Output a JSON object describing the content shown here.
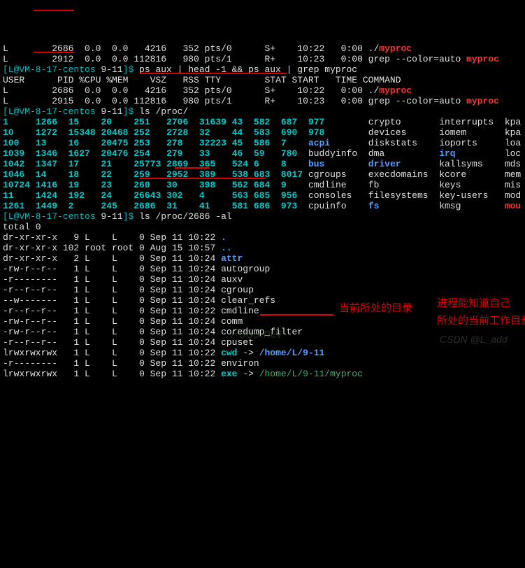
{
  "ps1": [
    {
      "user": "L",
      "pid": "2686",
      "cpu": "0.0",
      "mem": "0.0",
      "vsz": "4216",
      "rss": "352",
      "tty": "pts/0",
      "stat": "S+",
      "start": "10:22",
      "time": "0:00",
      "cmd": "./",
      "cmdsfx": "myproc"
    },
    {
      "user": "L",
      "pid": "2912",
      "cpu": "0.0",
      "mem": "0.0",
      "vsz": "112816",
      "rss": "980",
      "tty": "pts/1",
      "stat": "R+",
      "start": "10:23",
      "time": "0:00",
      "cmd": "grep --color=auto ",
      "cmdsfx": "myproc"
    }
  ],
  "prompt1": {
    "user": "L",
    "host": "VM-8-17-centos",
    "cwd": "9-11",
    "cmd": "ps aux | head -1 && ps aux | grep myproc"
  },
  "ps_header": {
    "user": "USER",
    "pid": "PID",
    "cpu": "%CPU",
    "mem": "%MEM",
    "vsz": "VSZ",
    "rss": "RSS",
    "tty": "TTY",
    "stat": "STAT",
    "start": "START",
    "time": "TIME",
    "cmd": "COMMAND"
  },
  "ps2": [
    {
      "user": "L",
      "pid": "2686",
      "cpu": "0.0",
      "mem": "0.0",
      "vsz": "4216",
      "rss": "352",
      "tty": "pts/0",
      "stat": "S+",
      "start": "10:22",
      "time": "0:00",
      "cmd": "./",
      "cmdsfx": "myproc"
    },
    {
      "user": "L",
      "pid": "2915",
      "cpu": "0.0",
      "mem": "0.0",
      "vsz": "112816",
      "rss": "980",
      "tty": "pts/1",
      "stat": "R+",
      "start": "10:23",
      "time": "0:00",
      "cmd": "grep --color=auto ",
      "cmdsfx": "myproc"
    }
  ],
  "prompt2": {
    "user": "L",
    "host": "VM-8-17-centos",
    "cwd": "9-11",
    "cmd": "ls /proc/"
  },
  "proc_rows": [
    [
      "1",
      "1266",
      "15",
      "20",
      "251",
      "2706",
      "31639",
      "43",
      "582",
      "687",
      "977",
      "",
      "crypto",
      "interrupts",
      "kpa"
    ],
    [
      "10",
      "1272",
      "15348",
      "20468",
      "252",
      "2728",
      "32",
      "44",
      "583",
      "690",
      "978",
      "",
      "devices",
      "iomem",
      "kpa"
    ],
    [
      "100",
      "13",
      "16",
      "20475",
      "253",
      "278",
      "32223",
      "45",
      "586",
      "7",
      "acpi",
      "",
      "diskstats",
      "ioports",
      "loa"
    ],
    [
      "1039",
      "1346",
      "1627",
      "20476",
      "254",
      "279",
      "33",
      "46",
      "59",
      "780",
      "buddyinfo",
      "",
      "dma",
      "irq",
      "loc"
    ],
    [
      "1042",
      "1347",
      "17",
      "21",
      "25773",
      "2869",
      "365",
      "524",
      "6",
      "8",
      "bus",
      "",
      "driver",
      "kallsyms",
      "mds"
    ],
    [
      "1046",
      "14",
      "18",
      "22",
      "259",
      "2952",
      "389",
      "538",
      "683",
      "8017",
      "cgroups",
      "",
      "execdomains",
      "kcore",
      "mem"
    ],
    [
      "10724",
      "1416",
      "19",
      "23",
      "260",
      "30",
      "398",
      "562",
      "684",
      "9",
      "cmdline",
      "",
      "fb",
      "keys",
      "mis"
    ],
    [
      "11",
      "1424",
      "192",
      "24",
      "26643",
      "302",
      "4",
      "563",
      "685",
      "956",
      "consoles",
      "",
      "filesystems",
      "key-users",
      "mod"
    ],
    [
      "1261",
      "1449",
      "2",
      "245",
      "2686",
      "31",
      "41",
      "581",
      "686",
      "973",
      "cpuinfo",
      "",
      "fs",
      "kmsg",
      "mou"
    ]
  ],
  "proc_styles": [
    [
      "cb",
      "cb",
      "cb",
      "cb",
      "cb",
      "cb",
      "cb",
      "cb",
      "cb",
      "cb",
      "cb",
      "",
      "w",
      "w",
      "w"
    ],
    [
      "cb",
      "cb",
      "cb",
      "cb",
      "cb",
      "cb",
      "cb",
      "cb",
      "cb",
      "cb",
      "cb",
      "",
      "w",
      "w",
      "w"
    ],
    [
      "cb",
      "cb",
      "cb",
      "cb",
      "cb",
      "cb",
      "cb",
      "cb",
      "cb",
      "cb",
      "bb",
      "",
      "w",
      "w",
      "w"
    ],
    [
      "cb",
      "cb",
      "cb",
      "cb",
      "cb",
      "cb",
      "cb",
      "cb",
      "cb",
      "cb",
      "w",
      "",
      "w",
      "bb",
      "w"
    ],
    [
      "cb",
      "cb",
      "cb",
      "cb",
      "cb",
      "cb",
      "cb",
      "cb",
      "cb",
      "cb",
      "bb",
      "",
      "bb",
      "w",
      "w"
    ],
    [
      "cb",
      "cb",
      "cb",
      "cb",
      "cb",
      "cb",
      "cb",
      "cb",
      "cb",
      "cb",
      "w",
      "",
      "w",
      "w",
      "w"
    ],
    [
      "cb",
      "cb",
      "cb",
      "cb",
      "cb",
      "cb",
      "cb",
      "cb",
      "cb",
      "cb",
      "w",
      "",
      "w",
      "w",
      "w"
    ],
    [
      "cb",
      "cb",
      "cb",
      "cb",
      "cb",
      "cb",
      "cb",
      "cb",
      "cb",
      "cb",
      "w",
      "",
      "w",
      "w",
      "w"
    ],
    [
      "cb",
      "cb",
      "cb",
      "cb",
      "cb",
      "cb",
      "cb",
      "cb",
      "cb",
      "cb",
      "w",
      "",
      "bb",
      "w",
      "rb"
    ]
  ],
  "prompt3": {
    "user": "L",
    "host": "VM-8-17-centos",
    "cwd": "9-11",
    "cmd": "ls /proc/2686 -al"
  },
  "total": "total 0",
  "ls": [
    {
      "perm": "dr-xr-xr-x",
      "ln": "9",
      "own": "L",
      "grp": "L",
      "sz": "0",
      "date": "Sep 11 10:22",
      "name": ".",
      "cls": "bb"
    },
    {
      "perm": "dr-xr-xr-x",
      "ln": "102",
      "own": "root",
      "grp": "root",
      "sz": "0",
      "date": "Aug 15 10:57",
      "name": "..",
      "cls": "bb"
    },
    {
      "perm": "dr-xr-xr-x",
      "ln": "2",
      "own": "L",
      "grp": "L",
      "sz": "0",
      "date": "Sep 11 10:24",
      "name": "attr",
      "cls": "bb"
    },
    {
      "perm": "-rw-r--r--",
      "ln": "1",
      "own": "L",
      "grp": "L",
      "sz": "0",
      "date": "Sep 11 10:24",
      "name": "autogroup",
      "cls": "w"
    },
    {
      "perm": "-r--------",
      "ln": "1",
      "own": "L",
      "grp": "L",
      "sz": "0",
      "date": "Sep 11 10:24",
      "name": "auxv",
      "cls": "w"
    },
    {
      "perm": "-r--r--r--",
      "ln": "1",
      "own": "L",
      "grp": "L",
      "sz": "0",
      "date": "Sep 11 10:24",
      "name": "cgroup",
      "cls": "w"
    },
    {
      "perm": "--w-------",
      "ln": "1",
      "own": "L",
      "grp": "L",
      "sz": "0",
      "date": "Sep 11 10:24",
      "name": "clear_refs",
      "cls": "w"
    },
    {
      "perm": "-r--r--r--",
      "ln": "1",
      "own": "L",
      "grp": "L",
      "sz": "0",
      "date": "Sep 11 10:22",
      "name": "cmdline",
      "cls": "w"
    },
    {
      "perm": "-rw-r--r--",
      "ln": "1",
      "own": "L",
      "grp": "L",
      "sz": "0",
      "date": "Sep 11 10:24",
      "name": "comm",
      "cls": "w"
    },
    {
      "perm": "-rw-r--r--",
      "ln": "1",
      "own": "L",
      "grp": "L",
      "sz": "0",
      "date": "Sep 11 10:24",
      "name": "coredump_filter",
      "cls": "w"
    },
    {
      "perm": "-r--r--r--",
      "ln": "1",
      "own": "L",
      "grp": "L",
      "sz": "0",
      "date": "Sep 11 10:24",
      "name": "cpuset",
      "cls": "w"
    },
    {
      "perm": "lrwxrwxrwx",
      "ln": "1",
      "own": "L",
      "grp": "L",
      "sz": "0",
      "date": "Sep 11 10:22",
      "name": "cwd",
      "cls": "cb",
      "arrow": " -> ",
      "target": "/home/L/9-11",
      "tcls": "bb"
    },
    {
      "perm": "-r--------",
      "ln": "1",
      "own": "L",
      "grp": "L",
      "sz": "0",
      "date": "Sep 11 10:22",
      "name": "environ",
      "cls": "w"
    },
    {
      "perm": "lrwxrwxrwx",
      "ln": "1",
      "own": "L",
      "grp": "L",
      "sz": "0",
      "date": "Sep 11 10:22",
      "name": "exe",
      "cls": "cb",
      "arrow": " -> ",
      "target": "/home/L/9-11/myproc",
      "tcls": "g"
    }
  ],
  "ann1": "当前所处的目录",
  "ann2": "进程能知道自己",
  "ann3": "所处的当前工作目录",
  "wm1": "CSDN @L_add",
  "wm2": "P969.net"
}
